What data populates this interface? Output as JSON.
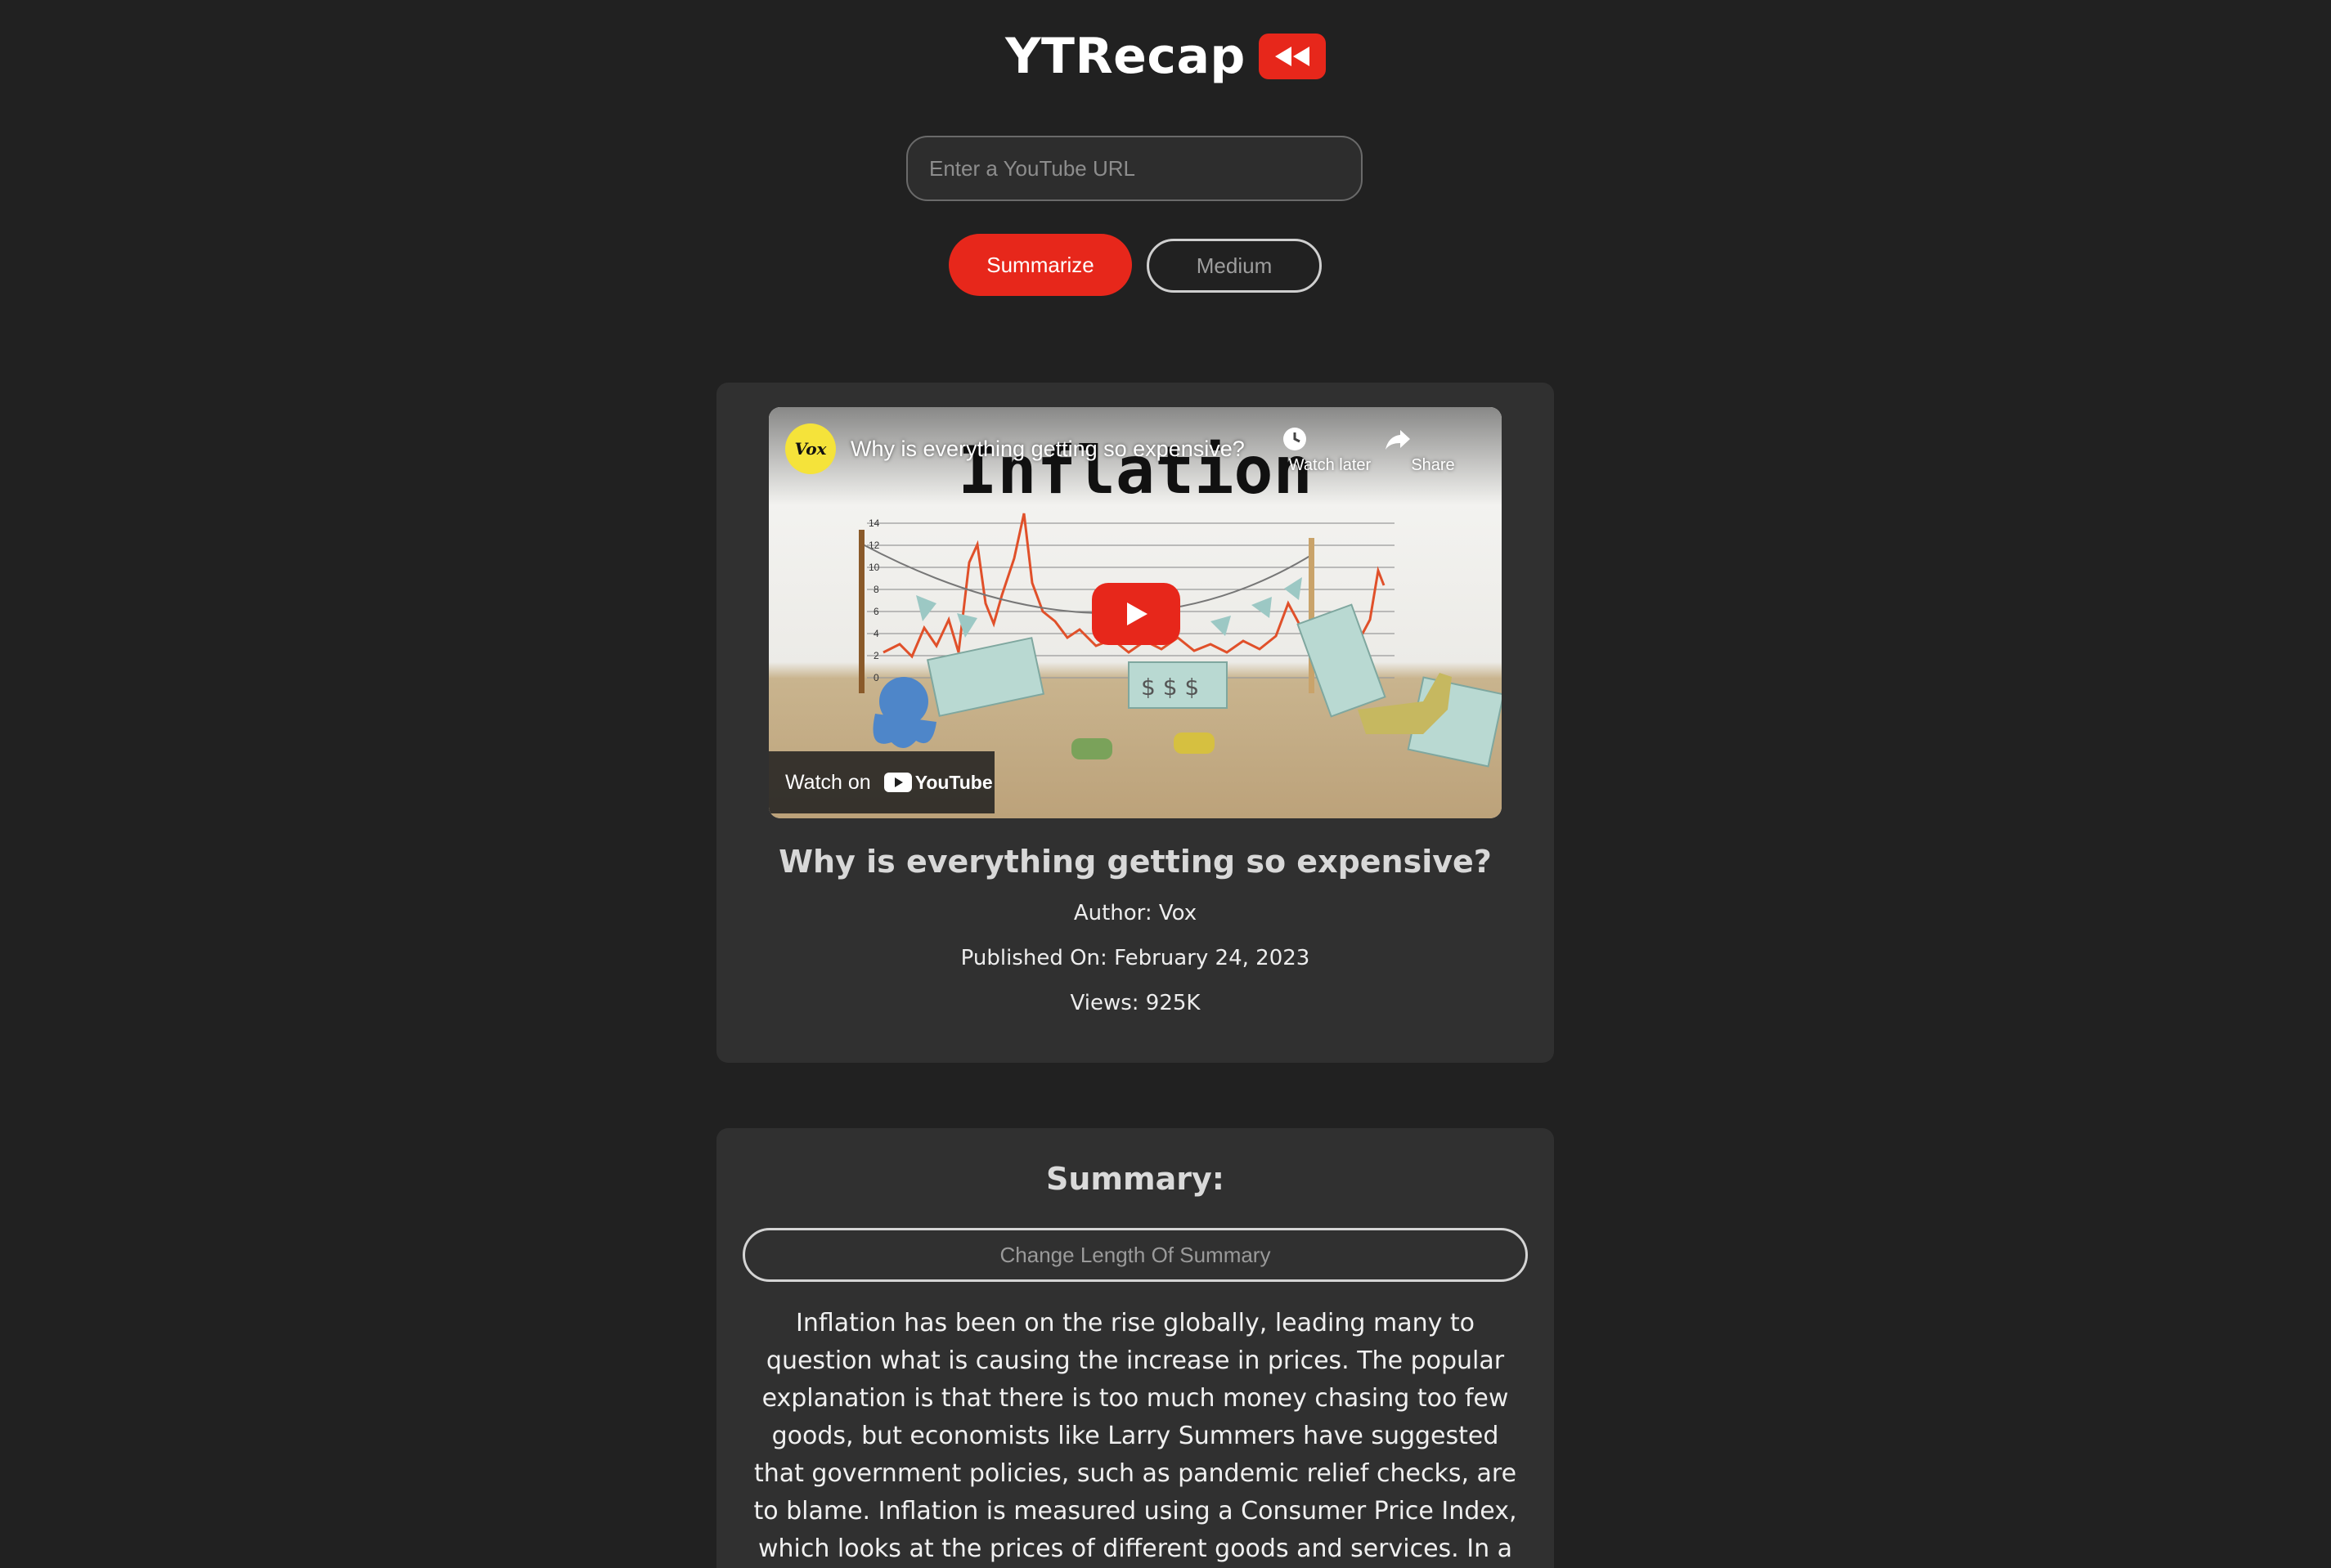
{
  "header": {
    "brand_title": "YTRecap",
    "logo_icon": "rewind-icon",
    "accent_color": "#e7271b"
  },
  "search": {
    "placeholder": "Enter a YouTube URL",
    "value": ""
  },
  "actions": {
    "summarize_label": "Summarize",
    "length_label": "Medium"
  },
  "video": {
    "embed": {
      "channel_avatar_text": "Vox",
      "title": "Why is everything getting so expensive?",
      "thumbnail_heading": "Inflation",
      "watch_later_label": "Watch later",
      "share_label": "Share",
      "watch_on_label": "Watch on",
      "youtube_logo_text": "YouTube",
      "chart_ticks": [
        "14",
        "12",
        "10",
        "8",
        "6",
        "4",
        "2",
        "0"
      ]
    },
    "title": "Why is everything getting so expensive?",
    "author": "Author: Vox",
    "published": "Published On: February 24, 2023",
    "views": "Views: 925K"
  },
  "summary": {
    "heading": "Summary:",
    "change_length_label": "Change Length Of Summary",
    "text": "Inflation has been on the rise globally, leading many to question what is causing the increase in prices. The popular explanation is that there is too much money chasing too few goods, but economists like Larry Summers have suggested that government policies, such as pandemic relief checks, are to blame. Inflation is measured using a Consumer Price Index, which looks at the prices of different goods and services. In a healthy economy, inflation"
  }
}
